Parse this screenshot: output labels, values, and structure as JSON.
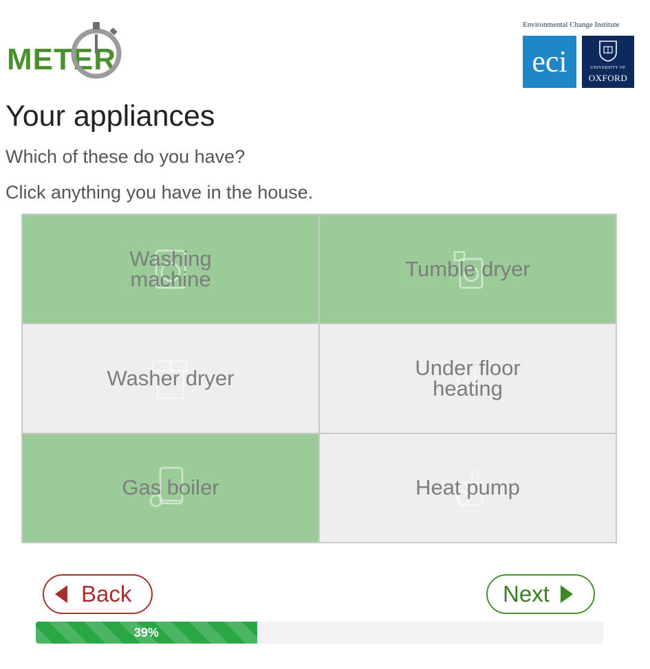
{
  "logos": {
    "meter": "METER",
    "eci_caption": "Environmental Change Institute",
    "eci": "eci",
    "oxford_small": "UNIVERSITY OF",
    "oxford_big": "OXFORD"
  },
  "page": {
    "title": "Your appliances",
    "question": "Which of these do you have?",
    "instruction": "Click anything you have in the house."
  },
  "appliances": [
    {
      "label": "Washing machine",
      "selected": true,
      "icon": "washing-machine-icon"
    },
    {
      "label": "Tumble dryer",
      "selected": true,
      "icon": "tumble-dryer-icon"
    },
    {
      "label": "Washer dryer",
      "selected": false,
      "icon": "washer-dryer-icon"
    },
    {
      "label": "Under floor heating",
      "selected": false,
      "icon": "underfloor-heating-icon"
    },
    {
      "label": "Gas boiler",
      "selected": true,
      "icon": "gas-boiler-icon"
    },
    {
      "label": "Heat pump",
      "selected": false,
      "icon": "heat-pump-icon"
    }
  ],
  "nav": {
    "back_label": "Back",
    "next_label": "Next"
  },
  "progress": {
    "value": 39,
    "label": "39%"
  },
  "colors": {
    "selected_tile": "#9acb98",
    "unselected_tile": "#eeeeee",
    "progress": "#2aa745",
    "back": "#a33030",
    "next": "#4a8f2e"
  }
}
